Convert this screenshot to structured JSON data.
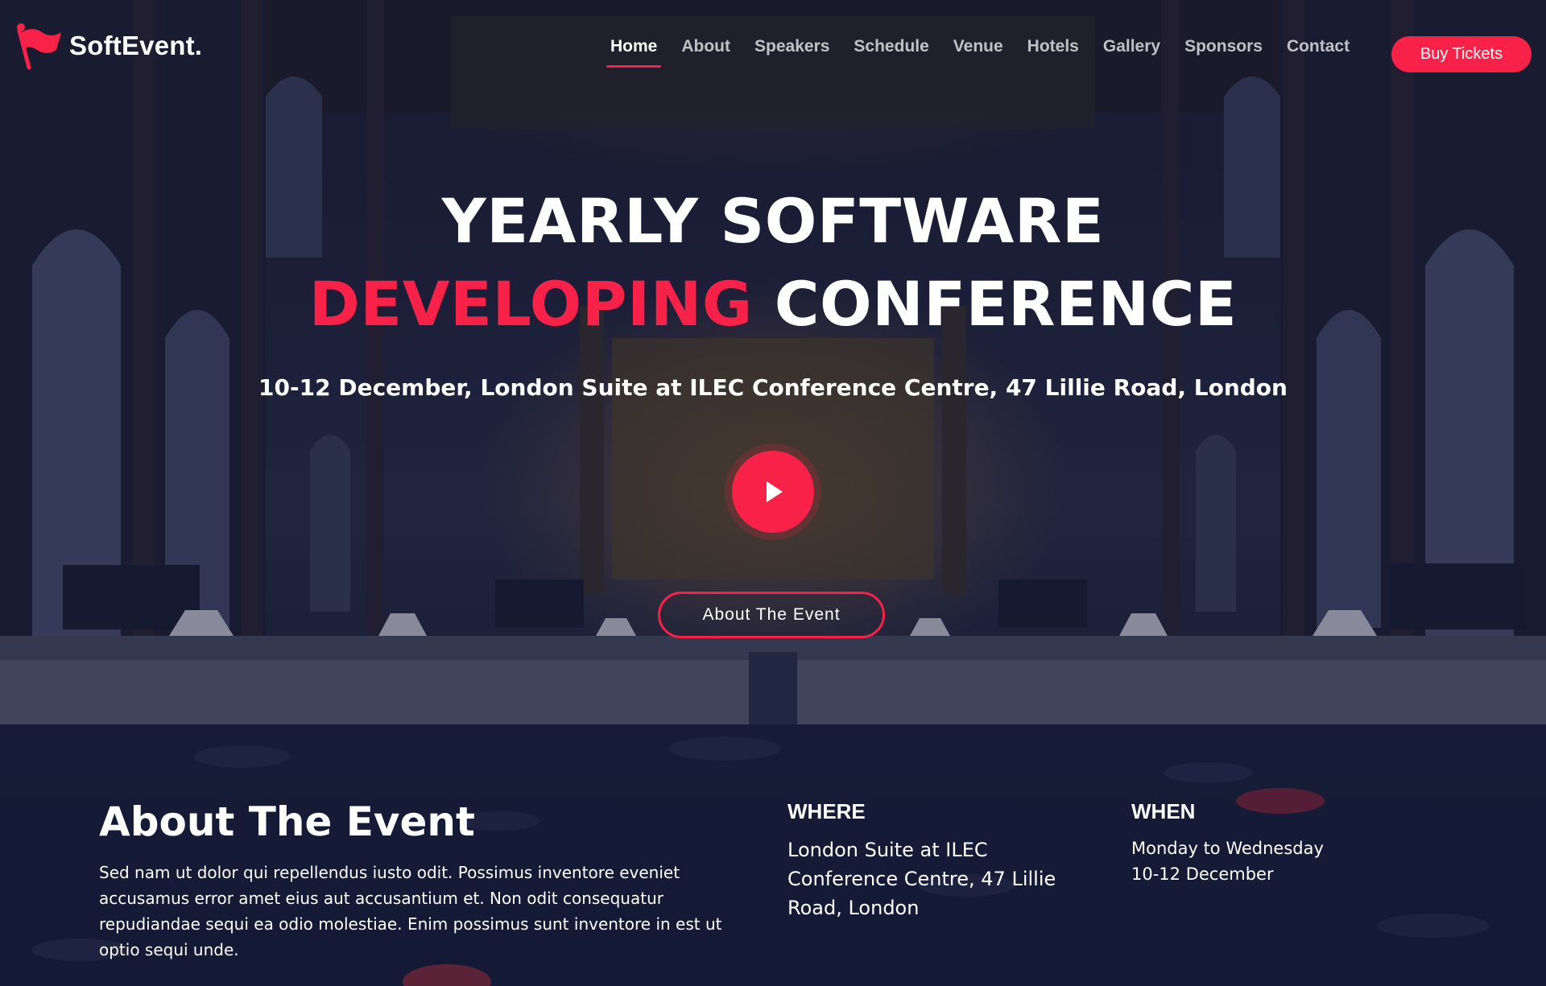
{
  "brand": {
    "logo_text": "SoftEvent.",
    "accent_color": "#f82249",
    "dark_color": "#161b37"
  },
  "nav": {
    "items": [
      {
        "label": "Home",
        "active": true
      },
      {
        "label": "About",
        "active": false
      },
      {
        "label": "Speakers",
        "active": false
      },
      {
        "label": "Schedule",
        "active": false
      },
      {
        "label": "Venue",
        "active": false
      },
      {
        "label": "Hotels",
        "active": false
      },
      {
        "label": "Gallery",
        "active": false
      },
      {
        "label": "Sponsors",
        "active": false
      },
      {
        "label": "Contact",
        "active": false
      }
    ],
    "cta_label": "Buy Tickets"
  },
  "hero": {
    "title_line1": "YEARLY SOFTWARE",
    "title_line2_accent": "DEVELOPING",
    "title_line2_rest": "CONFERENCE",
    "subtitle": "10-12 December, London Suite at ILEC Conference Centre, 47 Lillie Road, London",
    "play_icon": "play-icon",
    "button_label": "About The Event"
  },
  "about": {
    "title": "About The Event",
    "text": "Sed nam ut dolor qui repellendus iusto odit. Possimus inventore eveniet accusamus error amet eius aut accusantium et. Non odit consequatur repudiandae sequi ea odio molestiae. Enim possimus sunt inventore in est ut optio sequi unde.",
    "where_heading": "WHERE",
    "where_text": "London Suite at ILEC Conference Centre, 47 Lillie Road, London",
    "when_heading": "WHEN",
    "when_line1": "Monday to Wednesday",
    "when_line2": "10-12 December"
  }
}
